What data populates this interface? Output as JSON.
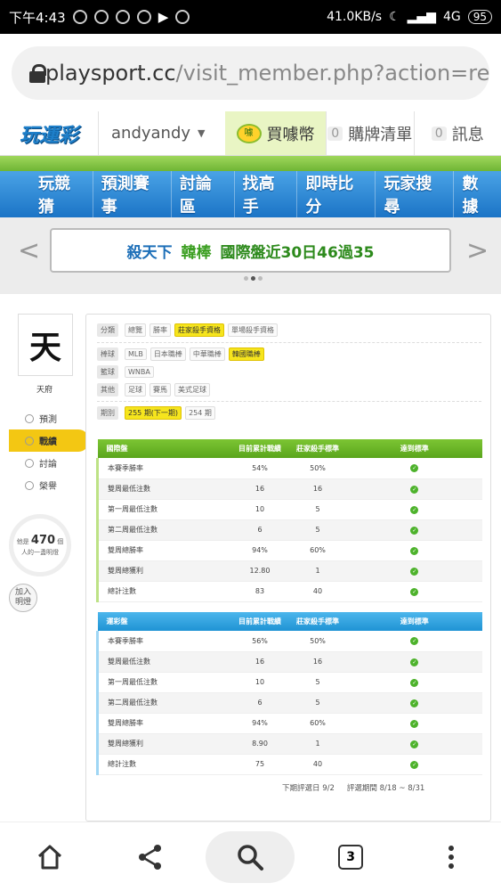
{
  "status": {
    "time": "下午4:43",
    "speed": "41.0KB/s",
    "network": "4G",
    "battery": "95"
  },
  "url": {
    "host": "playsport.cc",
    "path": "/visit_member.php?action=re"
  },
  "header": {
    "logo": "玩運彩",
    "username": "andyandy",
    "coins": "買噱幣",
    "coin_badge": "噱",
    "list_count": "0",
    "list_label": "購牌清單",
    "msg_count": "0",
    "msg_label": "訊息"
  },
  "nav": [
    "玩競猜",
    "預測賽事",
    "討論區",
    "找高手",
    "即時比分",
    "玩家搜尋",
    "數據"
  ],
  "promo": {
    "part1": "殺天下",
    "part2": "韓棒",
    "part3": "國際盤近30日46過35"
  },
  "profile": {
    "avatar_char": "天",
    "name": "天府",
    "menu": [
      "預測",
      "戰績",
      "討論",
      "榮譽"
    ],
    "bulb_pre": "他是",
    "bulb_num": "470",
    "bulb_post": "個",
    "bulb_line2": "人的一盞明燈",
    "join_line1": "加入",
    "join_line2": "明燈"
  },
  "filters": {
    "category": {
      "label": "分類",
      "tags": [
        "總覽",
        "勝率",
        "莊家殺手資格",
        "單場殺手資格"
      ]
    },
    "baseball": {
      "label": "棒球",
      "tags": [
        "MLB",
        "日本職棒",
        "中華職棒",
        "韓國職棒"
      ]
    },
    "basketball": {
      "label": "籃球",
      "tags": [
        "WNBA"
      ]
    },
    "other": {
      "label": "其他",
      "tags": [
        "足球",
        "賽馬",
        "美式足球"
      ]
    },
    "period": {
      "label": "期別",
      "tags": [
        "255 期(下一期)",
        "254 期"
      ]
    }
  },
  "table_intl": {
    "headers": [
      "國際盤",
      "目前累計戰績",
      "莊家殺手標準",
      "達到標準"
    ],
    "rows": [
      [
        "本賽季勝率",
        "54%",
        "50%"
      ],
      [
        "雙周最低注數",
        "16",
        "16"
      ],
      [
        "第一周最低注數",
        "10",
        "5"
      ],
      [
        "第二周最低注數",
        "6",
        "5"
      ],
      [
        "雙周總勝率",
        "94%",
        "60%"
      ],
      [
        "雙周總獲利",
        "12.80",
        "1"
      ],
      [
        "總計注數",
        "83",
        "40"
      ]
    ]
  },
  "table_lottery": {
    "headers": [
      "運彩盤",
      "目前累計戰績",
      "莊家殺手標準",
      "達到標準"
    ],
    "rows": [
      [
        "本賽季勝率",
        "56%",
        "50%"
      ],
      [
        "雙周最低注數",
        "16",
        "16"
      ],
      [
        "第一周最低注數",
        "10",
        "5"
      ],
      [
        "第二周最低注數",
        "6",
        "5"
      ],
      [
        "雙周總勝率",
        "94%",
        "60%"
      ],
      [
        "雙周總獲利",
        "8.90",
        "1"
      ],
      [
        "總計注數",
        "75",
        "40"
      ]
    ]
  },
  "footer": {
    "next_review": "下期評選日 9/2",
    "period": "評選期間 8/18 ~ 8/31"
  },
  "bottom": {
    "tabs": "3"
  },
  "colors": {
    "nav": "#1b74c6",
    "green": "#5aa51c",
    "yellow": "#f6e51d",
    "blue": "#1f93d4"
  }
}
